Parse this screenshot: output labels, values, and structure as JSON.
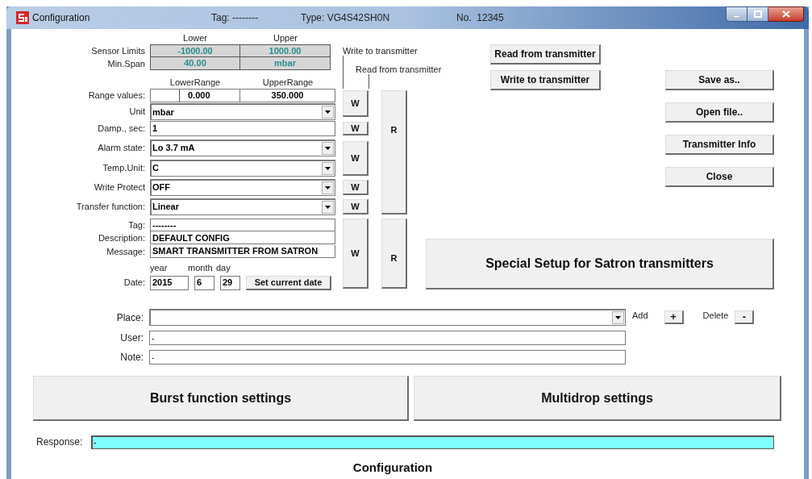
{
  "window": {
    "title": "Configuration",
    "tag": "Tag: --------",
    "type": "Type: VG4S42SH0N",
    "number": "No.  12345"
  },
  "sensor": {
    "headers": [
      "Lower",
      "Upper"
    ],
    "rows": [
      {
        "label": "Sensor Limits",
        "values": [
          "-1000.00",
          "1000.00"
        ]
      },
      {
        "label": "Min.Span",
        "values": [
          "40.00",
          "mbar"
        ]
      }
    ]
  },
  "range": {
    "headers": [
      "LowerRange",
      "UpperRange"
    ],
    "label": "Range values:",
    "values": [
      "0.000",
      "350.000"
    ]
  },
  "settings": [
    {
      "label": "Unit",
      "kind": "dropdown",
      "value": "mbar"
    },
    {
      "label": "Damp., sec:",
      "kind": "text",
      "value": "1"
    },
    {
      "label": "Alarm state:",
      "kind": "dropdown",
      "value": "Lo 3.7 mA"
    },
    {
      "label": "Temp.Unit:",
      "kind": "dropdown",
      "value": "C"
    },
    {
      "label": "Write Protect",
      "kind": "dropdown",
      "value": "OFF"
    },
    {
      "label": "Transfer function:",
      "kind": "dropdown",
      "value": "Linear"
    }
  ],
  "device_tag": {
    "label": "Tag:",
    "value": "--------"
  },
  "description": {
    "label": "Description:",
    "value": "DEFAULT CONFIG"
  },
  "message": {
    "label": "Message:",
    "value": "SMART TRANSMITTER FROM SATRON"
  },
  "date": {
    "label": "Date:",
    "year_header": "year",
    "month_header": "month",
    "day_header": "day",
    "year": "2015",
    "month": "6",
    "day": "29",
    "button": "Set current date"
  },
  "write_column": {
    "label": "Write to transmitter",
    "buttons": [
      "W",
      "W",
      "W",
      "W",
      "W",
      "W"
    ]
  },
  "read_column": {
    "label": "Read from transmitter",
    "buttons": [
      "R",
      "R"
    ]
  },
  "actions": [
    "Read from transmitter",
    "Write to transmitter"
  ],
  "file_buttons": [
    "Save as..",
    "Open file..",
    "Transmitter Info",
    "Close"
  ],
  "special_button": "Special Setup for Satron transmitters",
  "place": {
    "label": "Place:",
    "add_label": "Add",
    "add_button": "+",
    "delete_label": "Delete",
    "delete_button": "-"
  },
  "user": {
    "label": "User:",
    "value": "-"
  },
  "note": {
    "label": "Note:",
    "value": "-"
  },
  "big_buttons": [
    "Burst function settings",
    "Multidrop settings"
  ],
  "response": {
    "label": "Response:",
    "value": "-"
  },
  "footer": "Configuration"
}
